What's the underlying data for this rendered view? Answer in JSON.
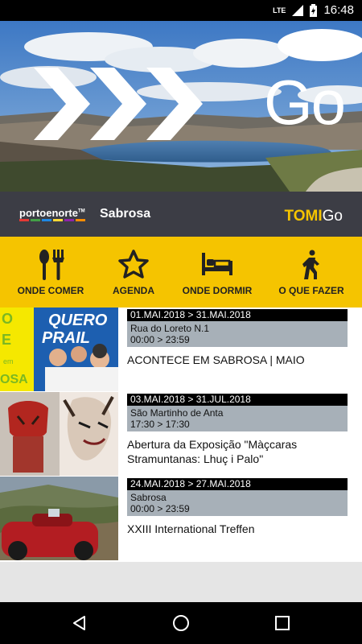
{
  "status": {
    "network": "LTE",
    "time": "16:48"
  },
  "hero": {
    "title": "Go",
    "icon": "triple-chevron-right-icon"
  },
  "brand": {
    "region_logo": "portoenorte",
    "region_tm": "TM",
    "city": "Sabrosa",
    "app_logo_part1": "TOMI",
    "app_logo_part2": "Go"
  },
  "nav": [
    {
      "label": "ONDE COMER",
      "icon": "spoon-fork-icon"
    },
    {
      "label": "AGENDA",
      "icon": "star-icon"
    },
    {
      "label": "ONDE DORMIR",
      "icon": "bed-icon"
    },
    {
      "label": "O QUE FAZER",
      "icon": "walking-person-icon"
    }
  ],
  "events": [
    {
      "date": "01.MAI.2018 > 31.MAI.2018",
      "place": "Rua do Loreto N.1",
      "time": "00:00 > 23:59",
      "title": "ACONTECE EM SABROSA | MAIO",
      "thumb_text_left": "O\nE\nem\nOSA",
      "thumb_text_top": "QUERO\nPRAIL"
    },
    {
      "date": "03.MAI.2018 > 31.JUL.2018",
      "place": "São Martinho de Anta",
      "time": "17:30 > 17:30",
      "title": "Abertura da Exposição \"Màçcaras Stramuntanas: Lhuç i Palo\""
    },
    {
      "date": "24.MAI.2018 > 27.MAI.2018",
      "place": "Sabrosa",
      "time": "00:00 > 23:59",
      "title": "XXIII International Treffen"
    }
  ],
  "colors": {
    "accent": "#f5c400",
    "brand_bar": "#3c3d45",
    "date_bg": "#000000",
    "place_bg": "#a7b0b8"
  }
}
